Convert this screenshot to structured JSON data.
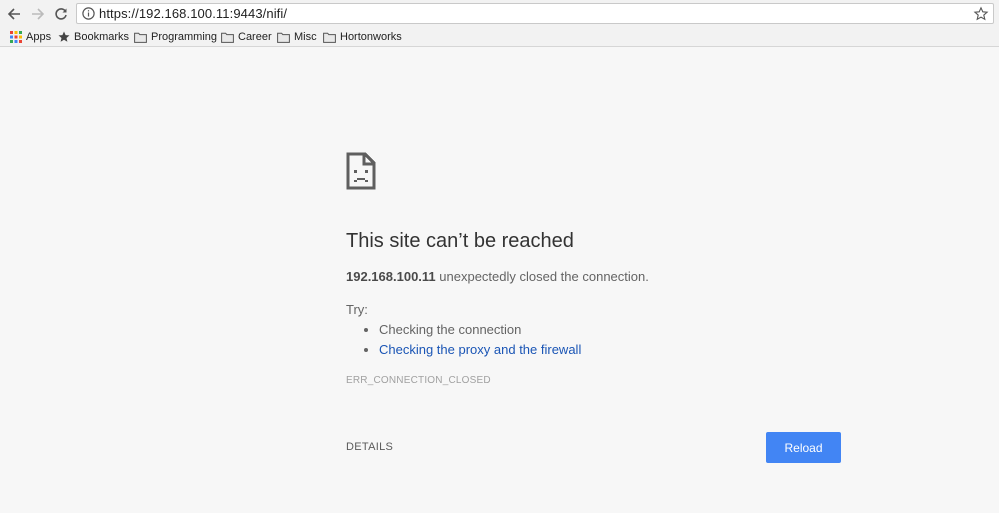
{
  "browser": {
    "url": "https://192.168.100.11:9443/nifi/",
    "icons": {
      "back": "back-arrow-icon",
      "forward": "forward-arrow-icon",
      "reload": "reload-icon",
      "info": "info-icon",
      "bookmark_star": "star-icon"
    }
  },
  "bookmarks_bar": {
    "items": [
      {
        "label": "Apps",
        "icon": "apps-grid-icon"
      },
      {
        "label": "Bookmarks",
        "icon": "star-icon"
      },
      {
        "label": "Programming",
        "icon": "folder-icon"
      },
      {
        "label": "Career",
        "icon": "folder-icon"
      },
      {
        "label": "Misc",
        "icon": "folder-icon"
      },
      {
        "label": "Hortonworks",
        "icon": "folder-icon"
      }
    ]
  },
  "error_page": {
    "icon": "sad-document-icon",
    "heading": "This site can’t be reached",
    "host": "192.168.100.11",
    "message": " unexpectedly closed the connection.",
    "try_label": "Try:",
    "suggestions": [
      {
        "text": "Checking the connection",
        "link": false
      },
      {
        "text": "Checking the proxy and the firewall",
        "link": true
      }
    ],
    "error_code": "ERR_CONNECTION_CLOSED",
    "details_label": "DETAILS",
    "reload_label": "Reload"
  },
  "colors": {
    "link": "#1a55b5",
    "reload_button": "#4285f4",
    "page_background": "#f7f7f7"
  }
}
